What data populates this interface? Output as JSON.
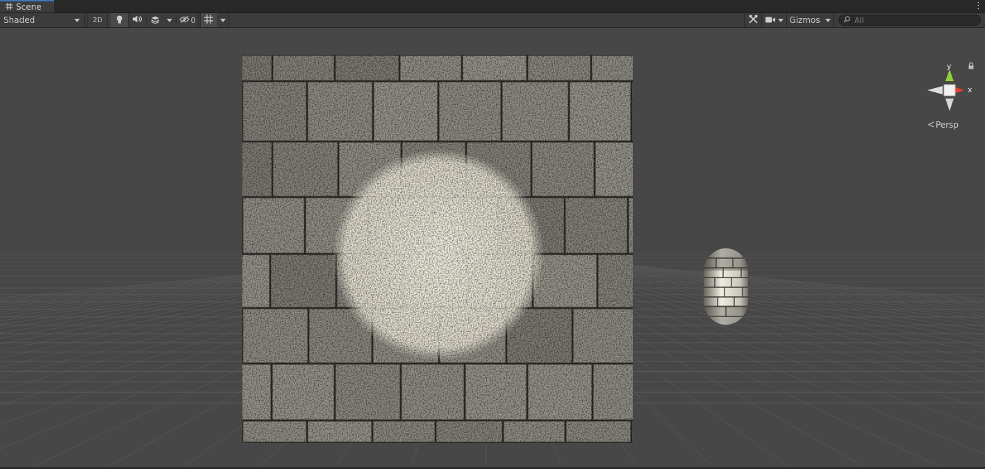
{
  "window": {
    "tab_label": "Scene"
  },
  "toolbar": {
    "shading_mode": "Shaded",
    "btn_2d": "2D",
    "hidden_count": "0",
    "gizmos_label": "Gizmos",
    "search_placeholder": "All"
  },
  "viewport": {
    "projection_label": "Persp",
    "axis_y": "y",
    "axis_x": "x"
  },
  "colors": {
    "accent": "#3a79bb",
    "axis_y": "#8ed23a",
    "axis_x": "#e0402a",
    "background": "#474747"
  }
}
